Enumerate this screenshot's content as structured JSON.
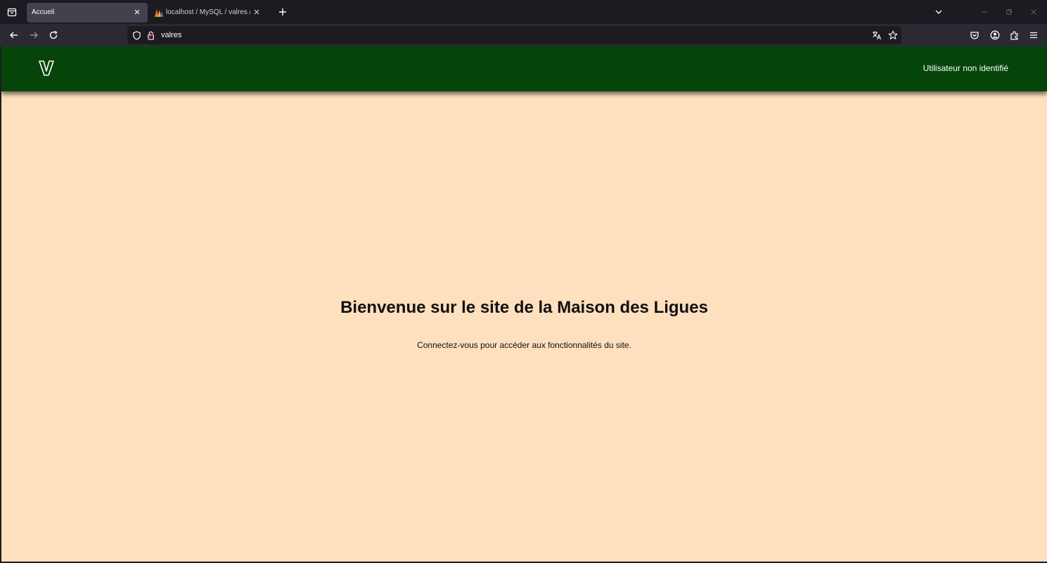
{
  "browser": {
    "tabs": [
      {
        "title": "Accueil",
        "active": true
      },
      {
        "title": "localhost / MySQL / valres / utilisateur",
        "active": false
      }
    ],
    "address": "valres"
  },
  "site": {
    "logo_letter": "V",
    "user_status": "Utilisateur non identifié",
    "welcome_title": "Bienvenue sur le site de la Maison des Ligues",
    "welcome_text": "Connectez-vous pour accéder aux fonctionnalités du site."
  },
  "colors": {
    "header_bg": "#064509",
    "page_bg": "#fedfbe",
    "browser_bg": "#1c1b22"
  }
}
